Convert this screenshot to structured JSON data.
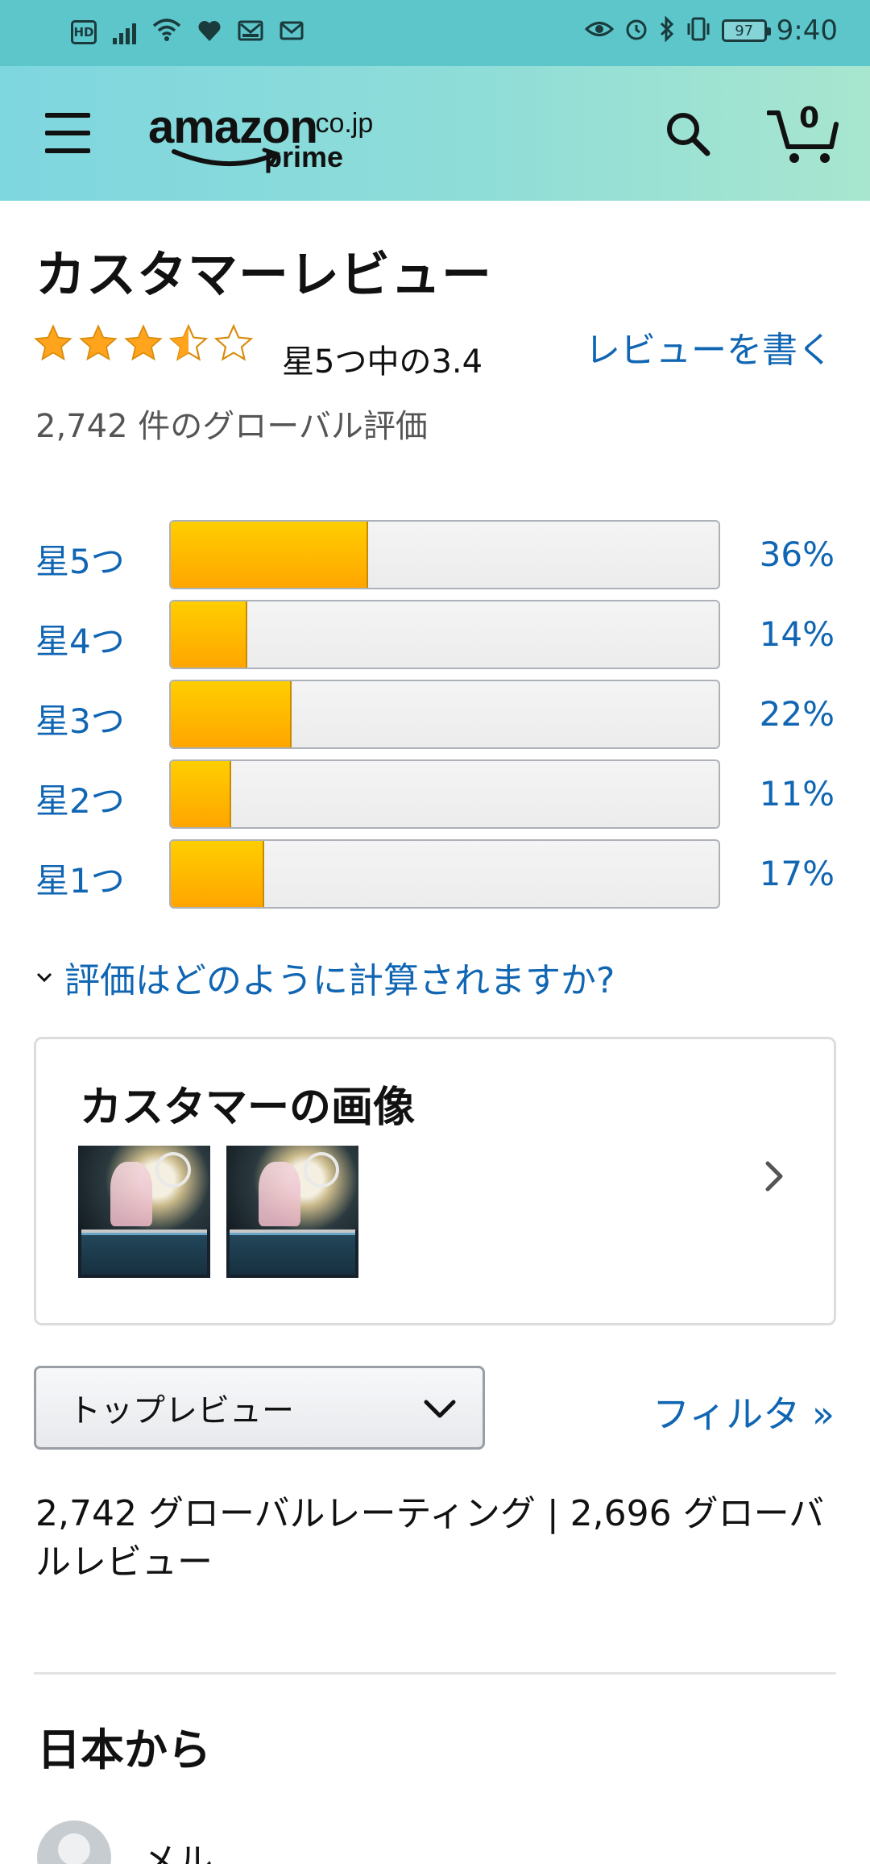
{
  "status_bar": {
    "hd_label": "HD",
    "battery": "97",
    "time": "9:40"
  },
  "header": {
    "logo_main": "amazon",
    "logo_tld": ".co.jp",
    "logo_prime": "prime",
    "cart_count": "0"
  },
  "reviews": {
    "title": "カスタマーレビュー",
    "rating": 3.4,
    "rating_text": "星5つ中の3.4",
    "write_review": "レビューを書く",
    "global_count": "2,742 件のグローバル評価",
    "histogram": [
      {
        "label": "星5つ",
        "percent": 36,
        "percent_label": "36%"
      },
      {
        "label": "星4つ",
        "percent": 14,
        "percent_label": "14%"
      },
      {
        "label": "星3つ",
        "percent": 22,
        "percent_label": "22%"
      },
      {
        "label": "星2つ",
        "percent": 11,
        "percent_label": "11%"
      },
      {
        "label": "星1つ",
        "percent": 17,
        "percent_label": "17%"
      }
    ],
    "how_calculated": "評価はどのように計算されますか?"
  },
  "customer_images": {
    "title": "カスタマーの画像"
  },
  "sort": {
    "selected": "トップレビュー",
    "filter": "フィルタ »"
  },
  "summary": "2,742 グローバルレーティング | 2,696 グローバルレビュー",
  "from_japan": "日本から",
  "first_review": {
    "reviewer": "メル"
  },
  "colors": {
    "link": "#1066b3",
    "star": "#ffa41c",
    "bar_fill": "#ffb000",
    "status_bar": "#5cc6cb"
  }
}
